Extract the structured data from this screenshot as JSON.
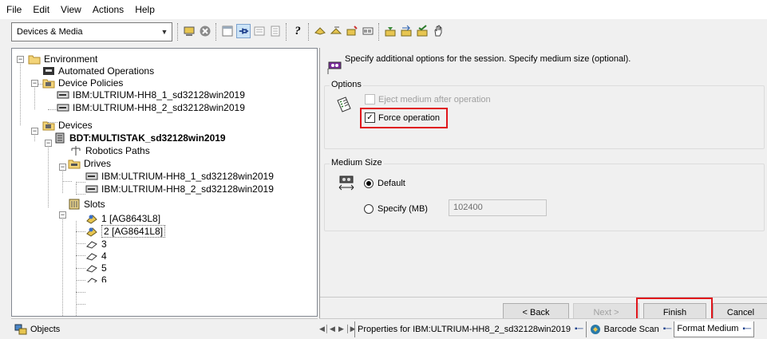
{
  "menu": [
    "File",
    "Edit",
    "View",
    "Actions",
    "Help"
  ],
  "toolbar": {
    "context_select": "Devices & Media",
    "help_glyph": "?"
  },
  "tree": {
    "environment": "Environment",
    "automated_operations": "Automated Operations",
    "device_policies": "Device Policies",
    "policy_1": "IBM:ULTRIUM-HH8_1_sd32128win2019",
    "policy_2": "IBM:ULTRIUM-HH8_2_sd32128win2019",
    "devices": "Devices",
    "library": "BDT:MULTISTAK_sd32128win2019",
    "robotics_paths": "Robotics Paths",
    "drives": "Drives",
    "drive_1": "IBM:ULTRIUM-HH8_1_sd32128win2019",
    "drive_2": "IBM:ULTRIUM-HH8_2_sd32128win2019",
    "slots": "Slots",
    "slot_1": "1 [AG8643L8]",
    "slot_2": "2 [AG8641L8]",
    "slot_3": "3",
    "slot_4": "4",
    "slot_5": "5",
    "slot_6": "6"
  },
  "objects_tab": "Objects",
  "wizard": {
    "intro": "Specify additional options for the session. Specify medium size (optional).",
    "options_title": "Options",
    "eject_label": "Eject medium after operation",
    "eject_checked": false,
    "force_label": "Force operation",
    "force_checked": true,
    "medium_size_title": "Medium Size",
    "default_label": "Default",
    "specify_label": "Specify (MB)",
    "specify_value": "102400",
    "selected_option": "Default",
    "back_label": "< Back",
    "next_label": "Next >",
    "finish_label": "Finish",
    "cancel_label": "Cancel"
  },
  "bottom_tabs": {
    "tab1": "Properties for IBM:ULTRIUM-HH8_2_sd32128win2019",
    "tab2": "Barcode Scan",
    "tab3": "Format Medium"
  },
  "colors": {
    "highlight": "#e0151b",
    "selection_bg": "#cce4f7"
  }
}
